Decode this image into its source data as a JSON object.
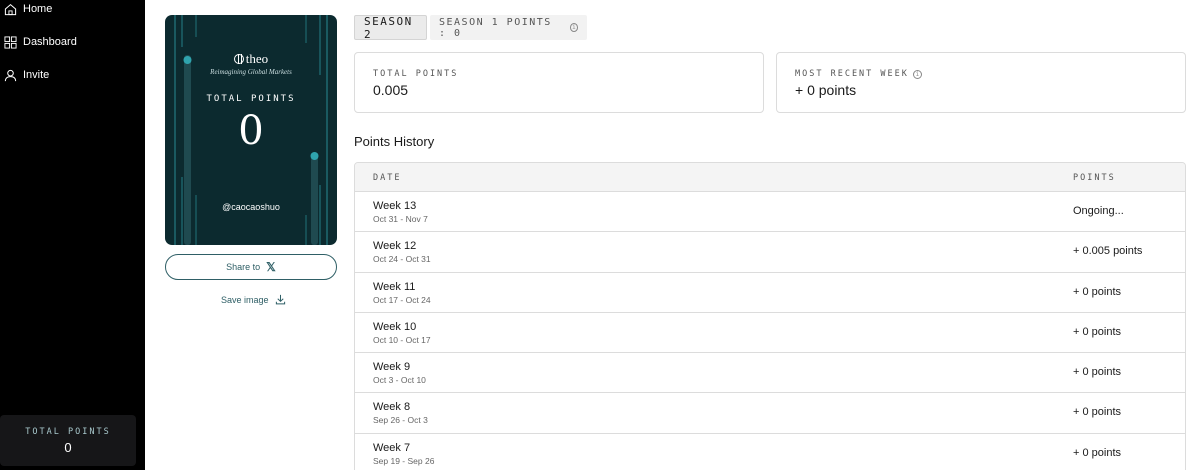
{
  "sidebar": {
    "items": [
      {
        "label": "Home",
        "icon": "home-icon"
      },
      {
        "label": "Dashboard",
        "icon": "grid-icon"
      },
      {
        "label": "Invite",
        "icon": "user-icon"
      }
    ],
    "total_label": "TOTAL POINTS",
    "total_value": "0"
  },
  "card": {
    "brand": "theo",
    "tagline": "Reimagining Global Markets",
    "label": "TOTAL POINTS",
    "value": "0",
    "handle": "@caocaoshuo",
    "bg_color": "#0c2a2f",
    "accent_color": "#2fa3ad"
  },
  "share": {
    "label": "Share to",
    "icon": "x-logo-icon",
    "icon_glyph": "𝕏"
  },
  "save": {
    "label": "Save image",
    "icon": "download-icon"
  },
  "seasons": {
    "current_label": "SEASON 2",
    "previous_label": "SEASON 1 POINTS : 0",
    "info_glyph": "i"
  },
  "stats": {
    "total_label": "TOTAL POINTS",
    "total_value": "0.005",
    "recent_label": "MOST RECENT WEEK",
    "recent_value": "+ 0 points"
  },
  "history": {
    "title": "Points History",
    "columns": {
      "date": "DATE",
      "points": "POINTS"
    },
    "rows": [
      {
        "week": "Week 13",
        "range": "Oct 31 - Nov 7",
        "points": "Ongoing..."
      },
      {
        "week": "Week 12",
        "range": "Oct 24 - Oct 31",
        "points": "+ 0.005 points"
      },
      {
        "week": "Week 11",
        "range": "Oct 17 - Oct 24",
        "points": "+ 0 points"
      },
      {
        "week": "Week 10",
        "range": "Oct 10 - Oct 17",
        "points": "+ 0 points"
      },
      {
        "week": "Week 9",
        "range": "Oct 3 - Oct 10",
        "points": "+ 0 points"
      },
      {
        "week": "Week 8",
        "range": "Sep 26 - Oct 3",
        "points": "+ 0 points"
      },
      {
        "week": "Week 7",
        "range": "Sep 19 - Sep 26",
        "points": "+ 0 points"
      }
    ]
  }
}
